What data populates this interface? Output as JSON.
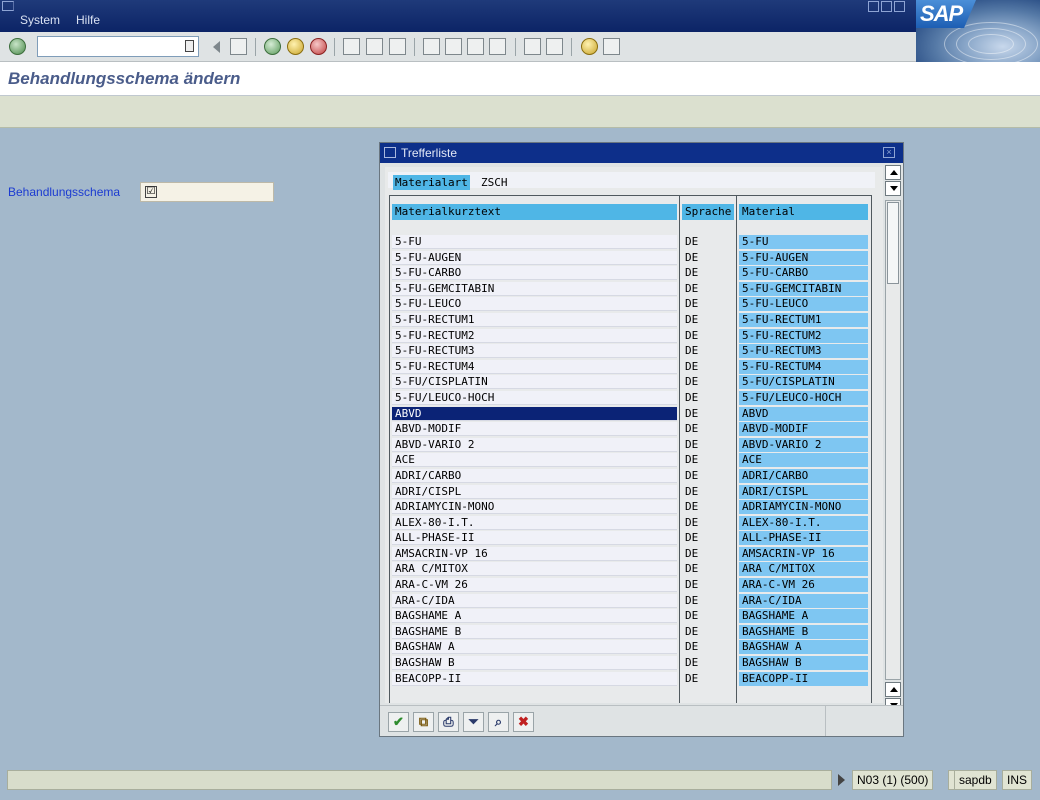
{
  "menu": {
    "items": [
      {
        "label": "System",
        "key": "S"
      },
      {
        "label": "Hilfe",
        "key": "H"
      }
    ]
  },
  "brand": {
    "logo_text": "SAP"
  },
  "page": {
    "title": "Behandlungsschema ändern"
  },
  "field": {
    "label": "Behandlungsschema",
    "value": "☑"
  },
  "popup": {
    "title": "Trefferliste",
    "filter": {
      "label": "Materialart",
      "value": "ZSCH"
    },
    "columns": {
      "short_text": "Materialkurztext",
      "language": "Sprache",
      "material": "Material"
    },
    "rows": [
      {
        "short_text": "5-FU",
        "language": "DE",
        "material": "5-FU"
      },
      {
        "short_text": "5-FU-AUGEN",
        "language": "DE",
        "material": "5-FU-AUGEN"
      },
      {
        "short_text": "5-FU-CARBO",
        "language": "DE",
        "material": "5-FU-CARBO"
      },
      {
        "short_text": "5-FU-GEMCITABIN",
        "language": "DE",
        "material": "5-FU-GEMCITABIN"
      },
      {
        "short_text": "5-FU-LEUCO",
        "language": "DE",
        "material": "5-FU-LEUCO"
      },
      {
        "short_text": "5-FU-RECTUM1",
        "language": "DE",
        "material": "5-FU-RECTUM1"
      },
      {
        "short_text": "5-FU-RECTUM2",
        "language": "DE",
        "material": "5-FU-RECTUM2"
      },
      {
        "short_text": "5-FU-RECTUM3",
        "language": "DE",
        "material": "5-FU-RECTUM3"
      },
      {
        "short_text": "5-FU-RECTUM4",
        "language": "DE",
        "material": "5-FU-RECTUM4"
      },
      {
        "short_text": "5-FU/CISPLATIN",
        "language": "DE",
        "material": "5-FU/CISPLATIN"
      },
      {
        "short_text": "5-FU/LEUCO-HOCH",
        "language": "DE",
        "material": "5-FU/LEUCO-HOCH"
      },
      {
        "short_text": "ABVD",
        "language": "DE",
        "material": "ABVD",
        "selected": true
      },
      {
        "short_text": "ABVD-MODIF",
        "language": "DE",
        "material": "ABVD-MODIF"
      },
      {
        "short_text": "ABVD-VARIO 2",
        "language": "DE",
        "material": "ABVD-VARIO 2"
      },
      {
        "short_text": "ACE",
        "language": "DE",
        "material": "ACE"
      },
      {
        "short_text": "ADRI/CARBO",
        "language": "DE",
        "material": "ADRI/CARBO"
      },
      {
        "short_text": "ADRI/CISPL",
        "language": "DE",
        "material": "ADRI/CISPL"
      },
      {
        "short_text": "ADRIAMYCIN-MONO",
        "language": "DE",
        "material": "ADRIAMYCIN-MONO"
      },
      {
        "short_text": "ALEX-80-I.T.",
        "language": "DE",
        "material": "ALEX-80-I.T."
      },
      {
        "short_text": "ALL-PHASE-II",
        "language": "DE",
        "material": "ALL-PHASE-II"
      },
      {
        "short_text": "AMSACRIN-VP 16",
        "language": "DE",
        "material": "AMSACRIN-VP 16"
      },
      {
        "short_text": "ARA C/MITOX",
        "language": "DE",
        "material": "ARA C/MITOX"
      },
      {
        "short_text": "ARA-C-VM 26",
        "language": "DE",
        "material": "ARA-C-VM 26"
      },
      {
        "short_text": "ARA-C/IDA",
        "language": "DE",
        "material": "ARA-C/IDA"
      },
      {
        "short_text": "BAGSHAME A",
        "language": "DE",
        "material": "BAGSHAME A"
      },
      {
        "short_text": "BAGSHAME B",
        "language": "DE",
        "material": "BAGSHAME B"
      },
      {
        "short_text": "BAGSHAW A",
        "language": "DE",
        "material": "BAGSHAW A"
      },
      {
        "short_text": "BAGSHAW B",
        "language": "DE",
        "material": "BAGSHAW B"
      },
      {
        "short_text": "BEACOPP-II",
        "language": "DE",
        "material": "BEACOPP-II"
      }
    ],
    "footer_buttons": [
      {
        "name": "confirm-button",
        "icon": "check-icon",
        "glyph": "✔",
        "color": "#2e8b2e"
      },
      {
        "name": "copy-button",
        "icon": "copy-icon",
        "glyph": "⧉",
        "color": "#7a5a10"
      },
      {
        "name": "print-button",
        "icon": "print-icon",
        "glyph": "⎙",
        "color": "#2a3a6a"
      },
      {
        "name": "filter-button",
        "icon": "filter-icon",
        "glyph": "⏷",
        "color": "#2a3a6a"
      },
      {
        "name": "find-button",
        "icon": "binoculars-icon",
        "glyph": "⌕",
        "color": "#2a3a6a"
      },
      {
        "name": "cancel-button",
        "icon": "cancel-icon",
        "glyph": "✖",
        "color": "#c02020"
      }
    ]
  },
  "status": {
    "session": "N03 (1) (500)",
    "server": "sapdb",
    "mode": "INS"
  }
}
